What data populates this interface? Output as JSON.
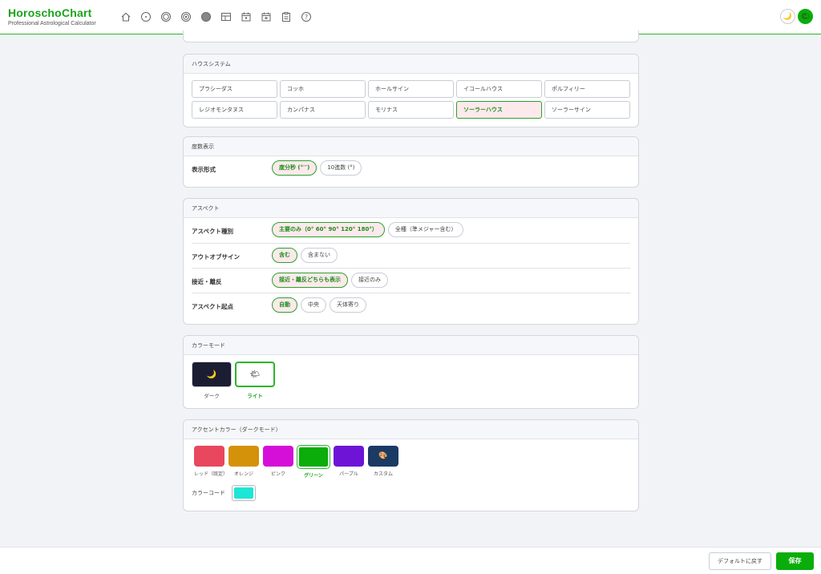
{
  "app": {
    "title": "HoroschoChart",
    "subtitle": "Professional Astrological Calculator"
  },
  "nav_icons": [
    "home-icon",
    "sun-icon",
    "natal-chart-icon",
    "transit-chart-icon",
    "progression-icon",
    "synastry-icon",
    "calendar-icon",
    "calendar-plus-icon",
    "clipboard-icon",
    "help-icon"
  ],
  "header_right": {
    "dark_mode_glyph": "🌙",
    "light_mode_glyph": "🌤"
  },
  "house_system": {
    "title": "ハウスシステム",
    "options": [
      "プラシーダス",
      "コッホ",
      "ホールサイン",
      "イコールハウス",
      "ポルフィリー",
      "レジオモンタヌス",
      "カンパナス",
      "モリナス",
      "ソーラーハウス",
      "ソーラーサイン"
    ],
    "selected": "ソーラーハウス"
  },
  "degree_display": {
    "title": "度数表示",
    "rows": [
      {
        "label": "表示形式",
        "options": [
          "度分秒 (°′″)",
          "10進数 (°)"
        ],
        "selected": 0
      }
    ]
  },
  "aspects": {
    "title": "アスペクト",
    "rows": [
      {
        "label": "アスペクト種別",
        "options": [
          "主要のみ（0° 60° 90° 120° 180°）",
          "全種（準メジャー含む）"
        ],
        "selected": 0
      },
      {
        "label": "アウトオブサイン",
        "options": [
          "含む",
          "含まない"
        ],
        "selected": 0
      },
      {
        "label": "接近・離反",
        "options": [
          "接近・離反どちらも表示",
          "接近のみ"
        ],
        "selected": 0
      },
      {
        "label": "アスペクト起点",
        "options": [
          "自動",
          "中央",
          "天体寄り"
        ],
        "selected": 0
      }
    ]
  },
  "color_mode": {
    "title": "カラーモード",
    "options": [
      {
        "label": "ダーク",
        "glyph": "🌙",
        "icon": "moon-icon"
      },
      {
        "label": "ライト",
        "glyph": "🌤",
        "icon": "sun-cloud-icon"
      }
    ],
    "selected": 1
  },
  "accent_color": {
    "title": "アクセントカラー（ダークモード）",
    "options": [
      {
        "label": "レッド（既定）",
        "color": "#e8475e"
      },
      {
        "label": "オレンジ",
        "color": "#d4920a"
      },
      {
        "label": "ピンク",
        "color": "#d50fd8"
      },
      {
        "label": "グリーン",
        "color": "#0aad0a"
      },
      {
        "label": "パープル",
        "color": "#6d14d6"
      },
      {
        "label": "カスタム",
        "color": "#1b3a64",
        "glyph": "🎨"
      }
    ],
    "selected": 3,
    "code_label": "カラーコード",
    "code_color": "#1de6d6"
  },
  "footer": {
    "reset_label": "デフォルトに戻す",
    "save_label": "保存"
  }
}
